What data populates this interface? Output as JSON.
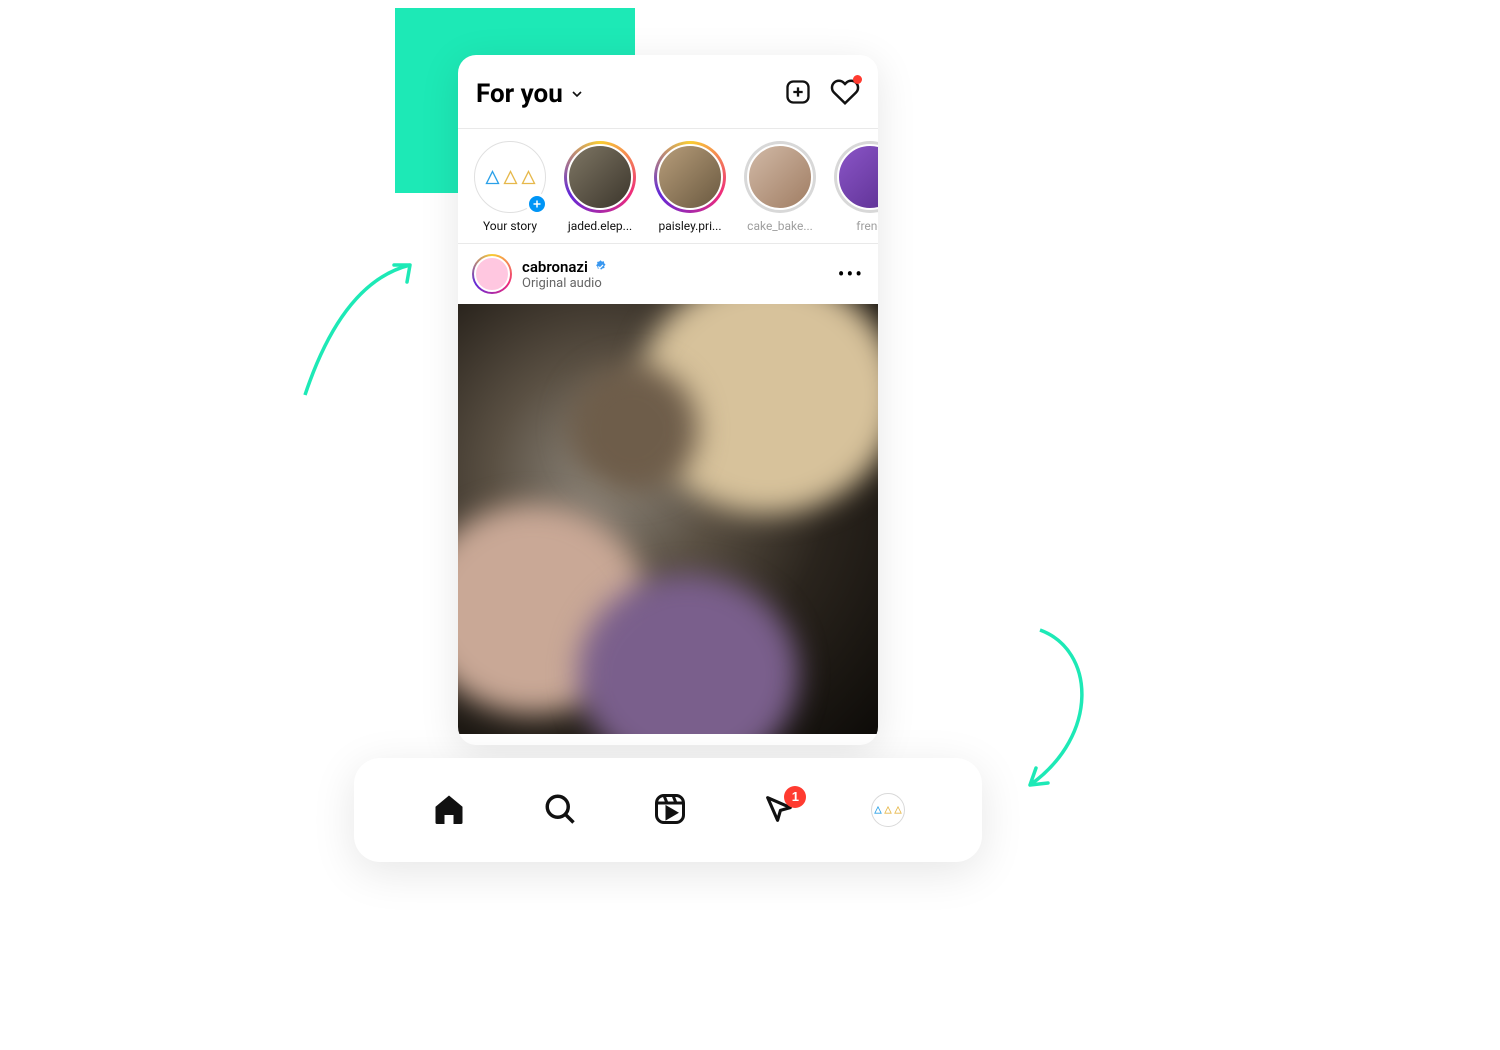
{
  "header": {
    "feed_label": "For you"
  },
  "stories": [
    {
      "label": "Your story",
      "ring": "own",
      "seen": false
    },
    {
      "label": "jaded.elep...",
      "ring": "active",
      "seen": false
    },
    {
      "label": "paisley.pri...",
      "ring": "active",
      "seen": false
    },
    {
      "label": "cake_bake...",
      "ring": "seen",
      "seen": true
    },
    {
      "label": "frenc",
      "ring": "seen",
      "seen": true
    }
  ],
  "post": {
    "username": "cabronazi",
    "verified": true,
    "subtitle": "Original audio"
  },
  "nav": {
    "notifications_badge": "1"
  },
  "colors": {
    "accent_block": "#1de9b6",
    "arrow": "#1de9b6",
    "notification": "#ff3b30",
    "verify": "#3897f0",
    "story_add": "#0095f6"
  }
}
